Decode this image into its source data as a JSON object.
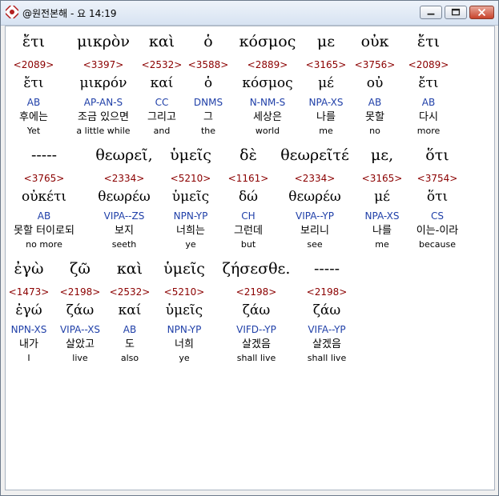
{
  "window": {
    "title": "@원전본해 - 요 14:19"
  },
  "rows": [
    {
      "words": [
        {
          "greek": "ἔτι",
          "num": "<2089>",
          "lemma": "ἔτι",
          "parse": "AB",
          "kor": "후에는",
          "eng": "Yet"
        },
        {
          "greek": "μικρὸν",
          "num": "<3397>",
          "lemma": "μικρόν",
          "parse": "AP-AN-S",
          "kor": "조금 있으면",
          "eng": "a little while"
        },
        {
          "greek": "καὶ",
          "num": "<2532>",
          "lemma": "καί",
          "parse": "CC",
          "kor": "그리고",
          "eng": "and"
        },
        {
          "greek": "ὁ",
          "num": "<3588>",
          "lemma": "ὁ",
          "parse": "DNMS",
          "kor": "그",
          "eng": "the"
        },
        {
          "greek": "κόσμος",
          "num": "<2889>",
          "lemma": "κόσμος",
          "parse": "N-NM-S",
          "kor": "세상은",
          "eng": "world"
        },
        {
          "greek": "με",
          "num": "<3165>",
          "lemma": "μέ",
          "parse": "NPA-XS",
          "kor": "나를",
          "eng": "me"
        },
        {
          "greek": "οὐκ",
          "num": "<3756>",
          "lemma": "οὐ",
          "parse": "AB",
          "kor": "못할",
          "eng": "no"
        },
        {
          "greek": "ἔτι",
          "num": "<2089>",
          "lemma": "ἔτι",
          "parse": "AB",
          "kor": "다시",
          "eng": "more"
        }
      ]
    },
    {
      "words": [
        {
          "greek": "-----",
          "num": "<3765>",
          "lemma": "οὐκέτι",
          "parse": "AB",
          "kor": "못할 터이로되",
          "eng": "no more"
        },
        {
          "greek": "θεωρεῖ,",
          "num": "<2334>",
          "lemma": "θεωρέω",
          "parse": "VIPA--ZS",
          "kor": "보지",
          "eng": "seeth"
        },
        {
          "greek": "ὑμεῖς",
          "num": "<5210>",
          "lemma": "ὑμεῖς",
          "parse": "NPN-YP",
          "kor": "너희는",
          "eng": "ye"
        },
        {
          "greek": "δὲ",
          "num": "<1161>",
          "lemma": "δώ",
          "parse": "CH",
          "kor": "그런데",
          "eng": "but"
        },
        {
          "greek": "θεωρεῖτέ",
          "num": "<2334>",
          "lemma": "θεωρέω",
          "parse": "VIPA--YP",
          "kor": "보리니",
          "eng": "see"
        },
        {
          "greek": "με,",
          "num": "<3165>",
          "lemma": "μέ",
          "parse": "NPA-XS",
          "kor": "나를",
          "eng": "me"
        },
        {
          "greek": "ὅτι",
          "num": "<3754>",
          "lemma": "ὅτι",
          "parse": "CS",
          "kor": "이는-이라",
          "eng": "because"
        }
      ]
    },
    {
      "words": [
        {
          "greek": "ἐγὼ",
          "num": "<1473>",
          "lemma": "ἐγώ",
          "parse": "NPN-XS",
          "kor": "내가",
          "eng": "I"
        },
        {
          "greek": "ζῶ",
          "num": "<2198>",
          "lemma": "ζάω",
          "parse": "VIPA--XS",
          "kor": "살았고",
          "eng": "live"
        },
        {
          "greek": "καὶ",
          "num": "<2532>",
          "lemma": "καί",
          "parse": "AB",
          "kor": "도",
          "eng": "also"
        },
        {
          "greek": "ὑμεῖς",
          "num": "<5210>",
          "lemma": "ὑμεῖς",
          "parse": "NPN-YP",
          "kor": "너희",
          "eng": "ye"
        },
        {
          "greek": "ζήσεσθε.",
          "num": "<2198>",
          "lemma": "ζάω",
          "parse": "VIFD--YP",
          "kor": "살겠음",
          "eng": "shall live"
        },
        {
          "greek": "-----",
          "num": "<2198>",
          "lemma": "ζάω",
          "parse": "VIFA--YP",
          "kor": "살겠음",
          "eng": "shall live"
        }
      ]
    }
  ]
}
